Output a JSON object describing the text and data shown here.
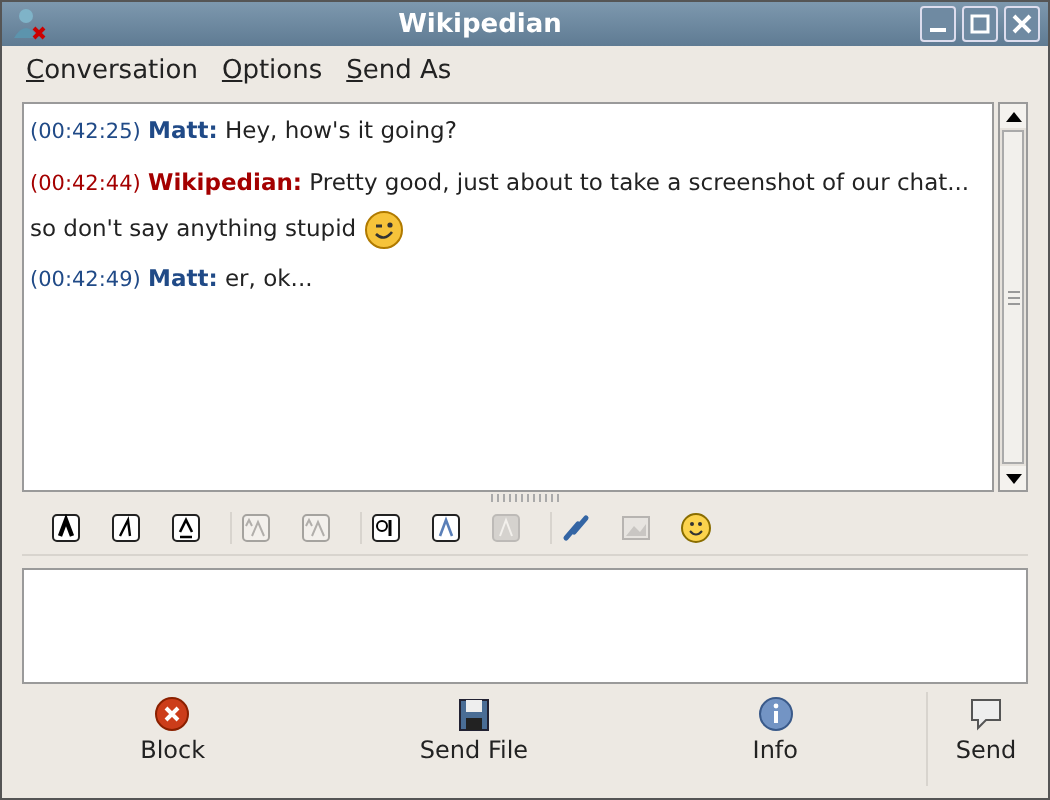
{
  "window": {
    "title": "Wikipedian"
  },
  "menu": [
    {
      "label": "Conversation"
    },
    {
      "label": "Options"
    },
    {
      "label": "Send As"
    }
  ],
  "messages": [
    {
      "time": "(00:42:25)",
      "sender": "Matt:",
      "text": "Hey, how's it going?",
      "color": "#204a87",
      "emoticon": false
    },
    {
      "time": "(00:42:44)",
      "sender": "Wikipedian:",
      "text": "Pretty good, just about to take a screenshot of our chat... so don't say anything stupid",
      "color": "#a40000",
      "emoticon": true
    },
    {
      "time": "(00:42:49)",
      "sender": "Matt:",
      "text": "er, ok...",
      "color": "#204a87",
      "emoticon": false
    }
  ],
  "toolbar": [
    [
      {
        "kind": "bold",
        "disabled": false
      },
      {
        "kind": "italic",
        "disabled": false
      },
      {
        "kind": "underline",
        "disabled": false
      }
    ],
    [
      {
        "kind": "larger",
        "disabled": true
      },
      {
        "kind": "smaller",
        "disabled": true
      }
    ],
    [
      {
        "kind": "font",
        "disabled": false
      },
      {
        "kind": "fgcolor",
        "disabled": false
      },
      {
        "kind": "bgcolor",
        "disabled": true
      }
    ],
    [
      {
        "kind": "link",
        "disabled": false
      },
      {
        "kind": "image",
        "disabled": true
      },
      {
        "kind": "smiley",
        "disabled": false
      }
    ]
  ],
  "actions": [
    {
      "kind": "block",
      "label": "Block"
    },
    {
      "kind": "file",
      "label": "Send File"
    },
    {
      "kind": "info",
      "label": "Info"
    }
  ],
  "send": {
    "label": "Send"
  }
}
